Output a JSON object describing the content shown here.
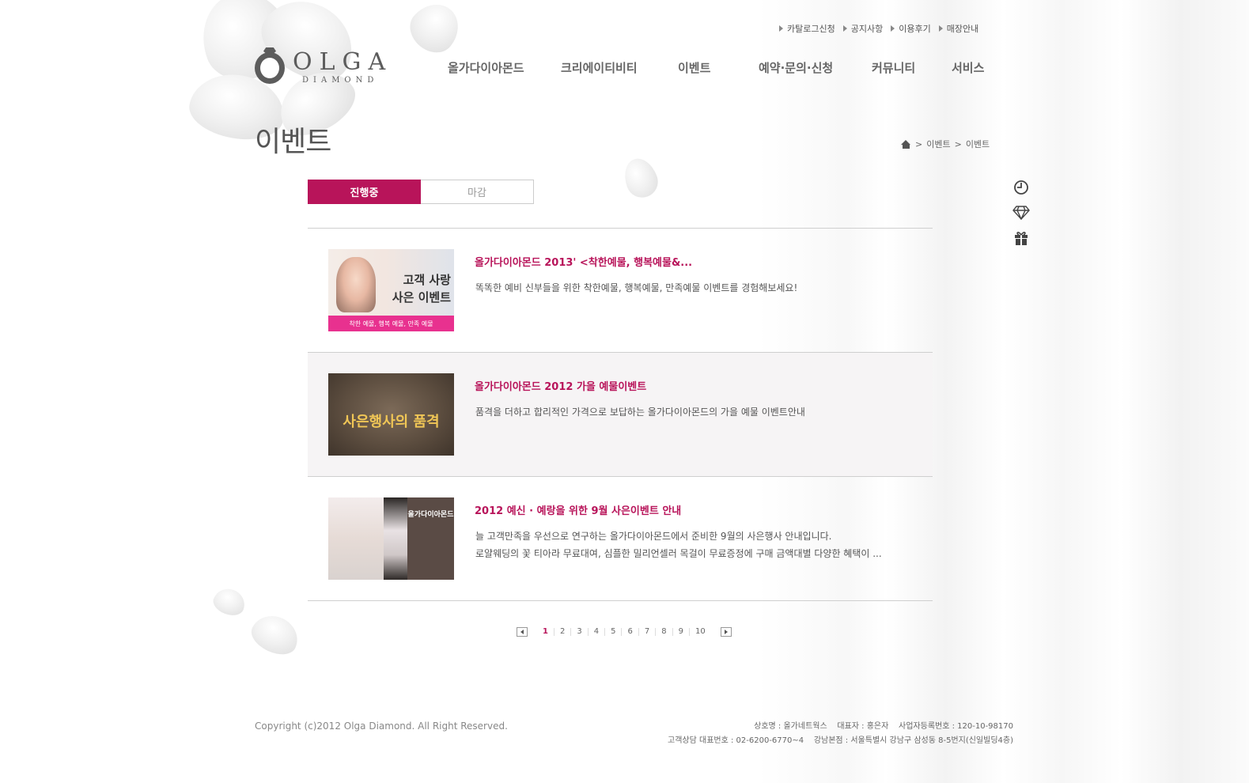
{
  "util_links": [
    "카탈로그신청",
    "공지사항",
    "이용후기",
    "매장안내"
  ],
  "logo": {
    "word": "OLGA",
    "sub": "DIAMOND"
  },
  "gnb": [
    "올가다이아몬드",
    "크리에이티비티",
    "이벤트",
    "예약·문의·신청",
    "커뮤니티",
    "서비스"
  ],
  "page_title": "이벤트",
  "breadcrumb": [
    "이벤트",
    "이벤트"
  ],
  "tabs": {
    "active": "진행중",
    "closed": "마감"
  },
  "quick_icons": [
    "clock-icon",
    "diamond-icon",
    "gift-icon"
  ],
  "events": [
    {
      "title": "올가다이아몬드 2013' <착한예물, 행복예물&...",
      "desc": [
        "똑똑한 예비 신부들을 위한 착한예물, 행복예물, 만족예물 이벤트를 경험해보세요!"
      ],
      "thumb": {
        "line1": "고객 사랑",
        "line2": "사은 이벤트",
        "bar": "착한 예물, 행복 예물, 만족 예물"
      }
    },
    {
      "title": "올가다이아몬드 2012 가을 예물이벤트",
      "desc": [
        "품격을 더하고 합리적인 가격으로 보답하는 올가다이아몬드의 가을 예물 이벤트안내"
      ],
      "thumb": {
        "line1": "사은행사의 품격"
      }
    },
    {
      "title": "2012 예신 · 예랑을 위한 9월 사은이벤트 안내",
      "desc": [
        "늘 고객만족을 우선으로 연구하는 올가다이아몬드에서 준비한 9월의 사은행사 안내입니다.",
        "로얄웨딩의 꽃 티아라 무료대여, 심플한 밀리언셀러 목걸이 무료증정에 구매 금액대별 다양한 혜택이 ..."
      ],
      "thumb": {
        "line1": "올가다이아몬드"
      }
    }
  ],
  "pagination": {
    "current": "1",
    "pages": [
      "1",
      "2",
      "3",
      "4",
      "5",
      "6",
      "7",
      "8",
      "9",
      "10"
    ]
  },
  "footer": {
    "copyright": "Copyright (c)2012 Olga Diamond. All Right Reserved.",
    "line1": "상호명 : 올가네트웍스    대표자 : 홍은자    사업자등록번호 : 120-10-98170",
    "line2": "고객상담 대표번호 : 02-6200-6770~4    강남본점 : 서울특별시 강남구 삼성동 8-5번지(신일빌딩4층)"
  },
  "colors": {
    "accent": "#b8145a",
    "text": "#555555"
  }
}
